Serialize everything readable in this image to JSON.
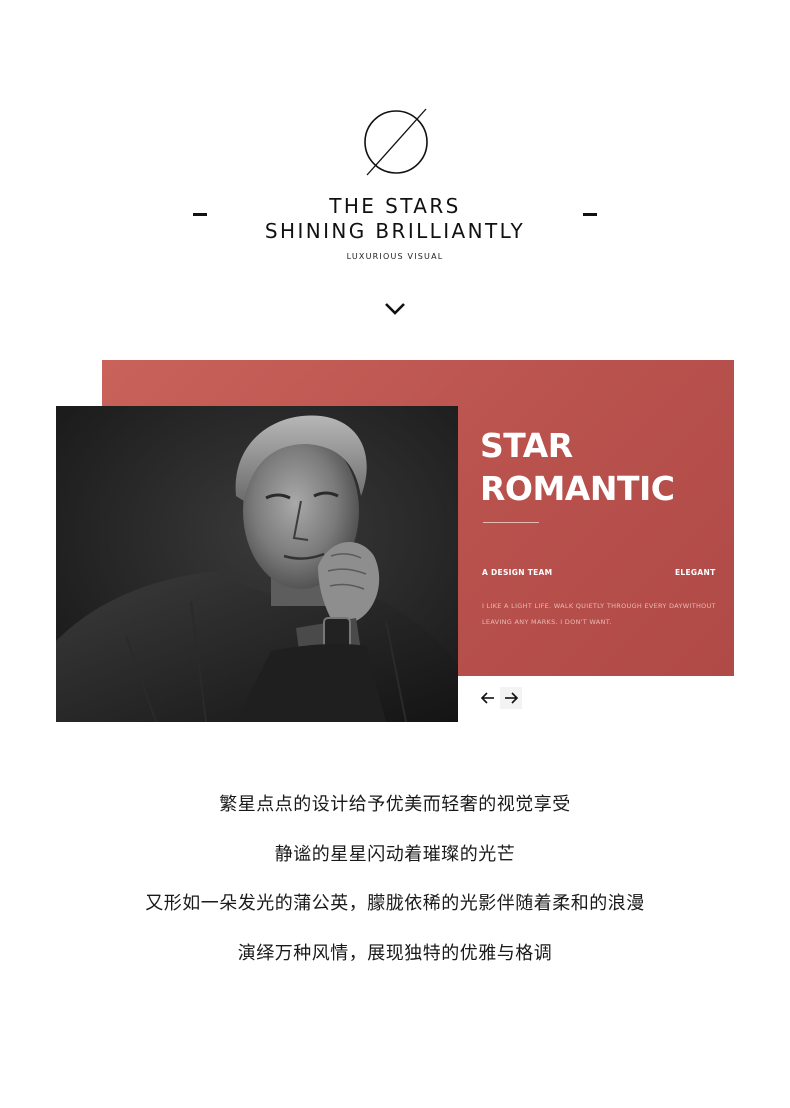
{
  "header": {
    "logo_icon": "circle-slash-logo-icon",
    "title_line1": "THE STARS",
    "title_line2": "SHINING BRILLIANTLY",
    "subtitle": "LUXURIOUS VISUAL",
    "scroll_icon": "chevron-down-icon"
  },
  "feature": {
    "panel_color": "#bd564f",
    "headline_line1": "STAR",
    "headline_line2": "ROMANTIC",
    "tag_left": "A DESIGN TEAM",
    "tag_right": "ELEGANT",
    "body_line1": "I LIKE A LIGHT LIFE. WALK QUIETLY THROUGH EVERY DAYWITHOUT",
    "body_line2": "LEAVING ANY MARKS. I DON'T WANT.",
    "prev_icon": "arrow-left-icon",
    "next_icon": "arrow-right-icon"
  },
  "copy": {
    "line1": "繁星点点的设计给予优美而轻奢的视觉享受",
    "line2": "静谧的星星闪动着璀璨的光芒",
    "line3": "又形如一朵发光的蒲公英，朦胧依稀的光影伴随着柔和的浪漫",
    "line4": "演绎万种风情，展现独特的优雅与格调"
  }
}
